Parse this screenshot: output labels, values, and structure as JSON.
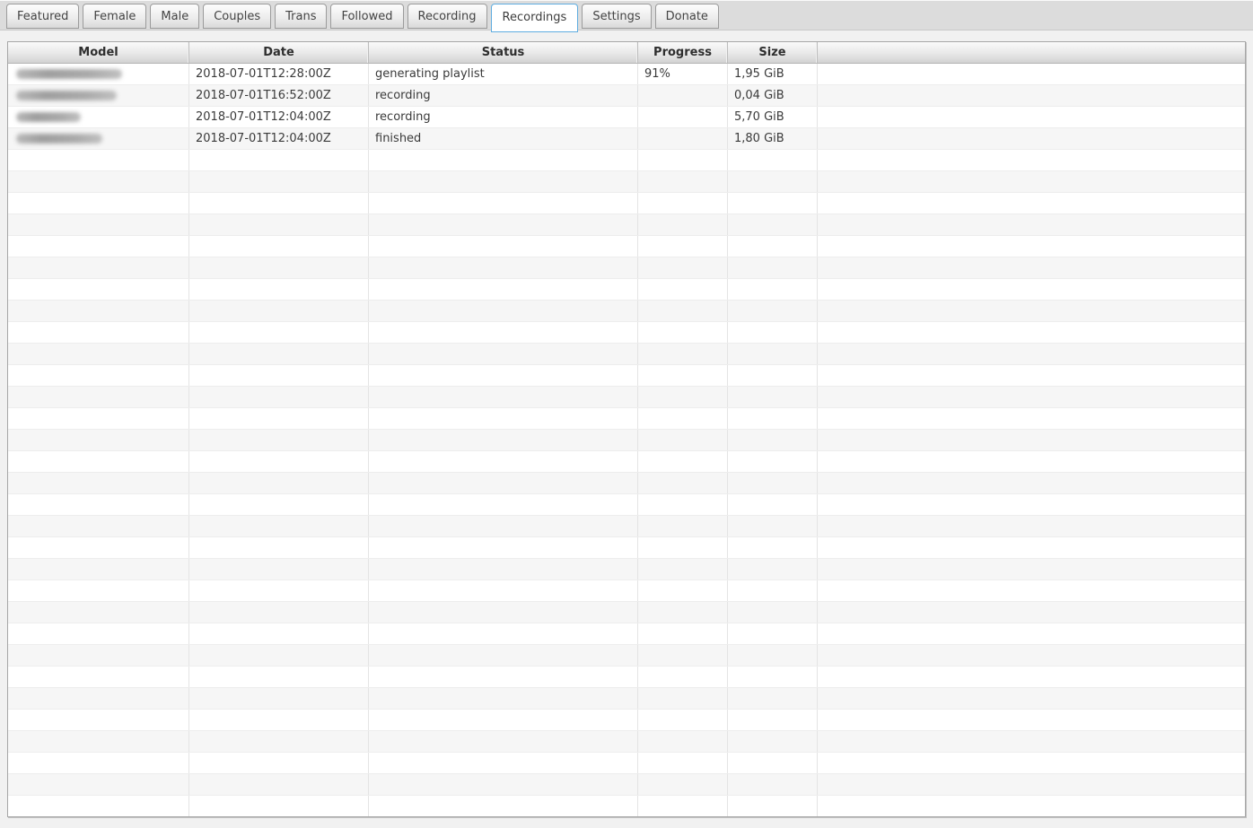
{
  "tabs": {
    "items": [
      {
        "label": "Featured",
        "active": false
      },
      {
        "label": "Female",
        "active": false
      },
      {
        "label": "Male",
        "active": false
      },
      {
        "label": "Couples",
        "active": false
      },
      {
        "label": "Trans",
        "active": false
      },
      {
        "label": "Followed",
        "active": false
      },
      {
        "label": "Recording",
        "active": false
      },
      {
        "label": "Recordings",
        "active": true
      },
      {
        "label": "Settings",
        "active": false
      },
      {
        "label": "Donate",
        "active": false
      }
    ]
  },
  "table": {
    "columns": [
      "Model",
      "Date",
      "Status",
      "Progress",
      "Size",
      ""
    ],
    "rows": [
      {
        "model": "",
        "model_redacted": true,
        "model_blur_width": 118,
        "date": "2018-07-01T12:28:00Z",
        "status": "generating playlist",
        "progress": "91%",
        "size": "1,95 GiB"
      },
      {
        "model": "",
        "model_redacted": true,
        "model_blur_width": 112,
        "date": "2018-07-01T16:52:00Z",
        "status": "recording",
        "progress": "",
        "size": "0,04 GiB"
      },
      {
        "model": "",
        "model_redacted": true,
        "model_blur_width": 72,
        "date": "2018-07-01T12:04:00Z",
        "status": "recording",
        "progress": "",
        "size": "5,70 GiB"
      },
      {
        "model": "",
        "model_redacted": true,
        "model_blur_width": 96,
        "date": "2018-07-01T12:04:00Z",
        "status": "finished",
        "progress": "",
        "size": "1,80 GiB"
      }
    ],
    "empty_row_count": 31
  },
  "colors": {
    "active_tab_border": "#5fade0",
    "tabbar_background": "#dcdcdc",
    "row_stripe": "#f6f6f6",
    "header_gradient_top": "#fafafa",
    "header_gradient_bottom": "#d2d2d2",
    "cell_text": "#3a3a3a"
  }
}
